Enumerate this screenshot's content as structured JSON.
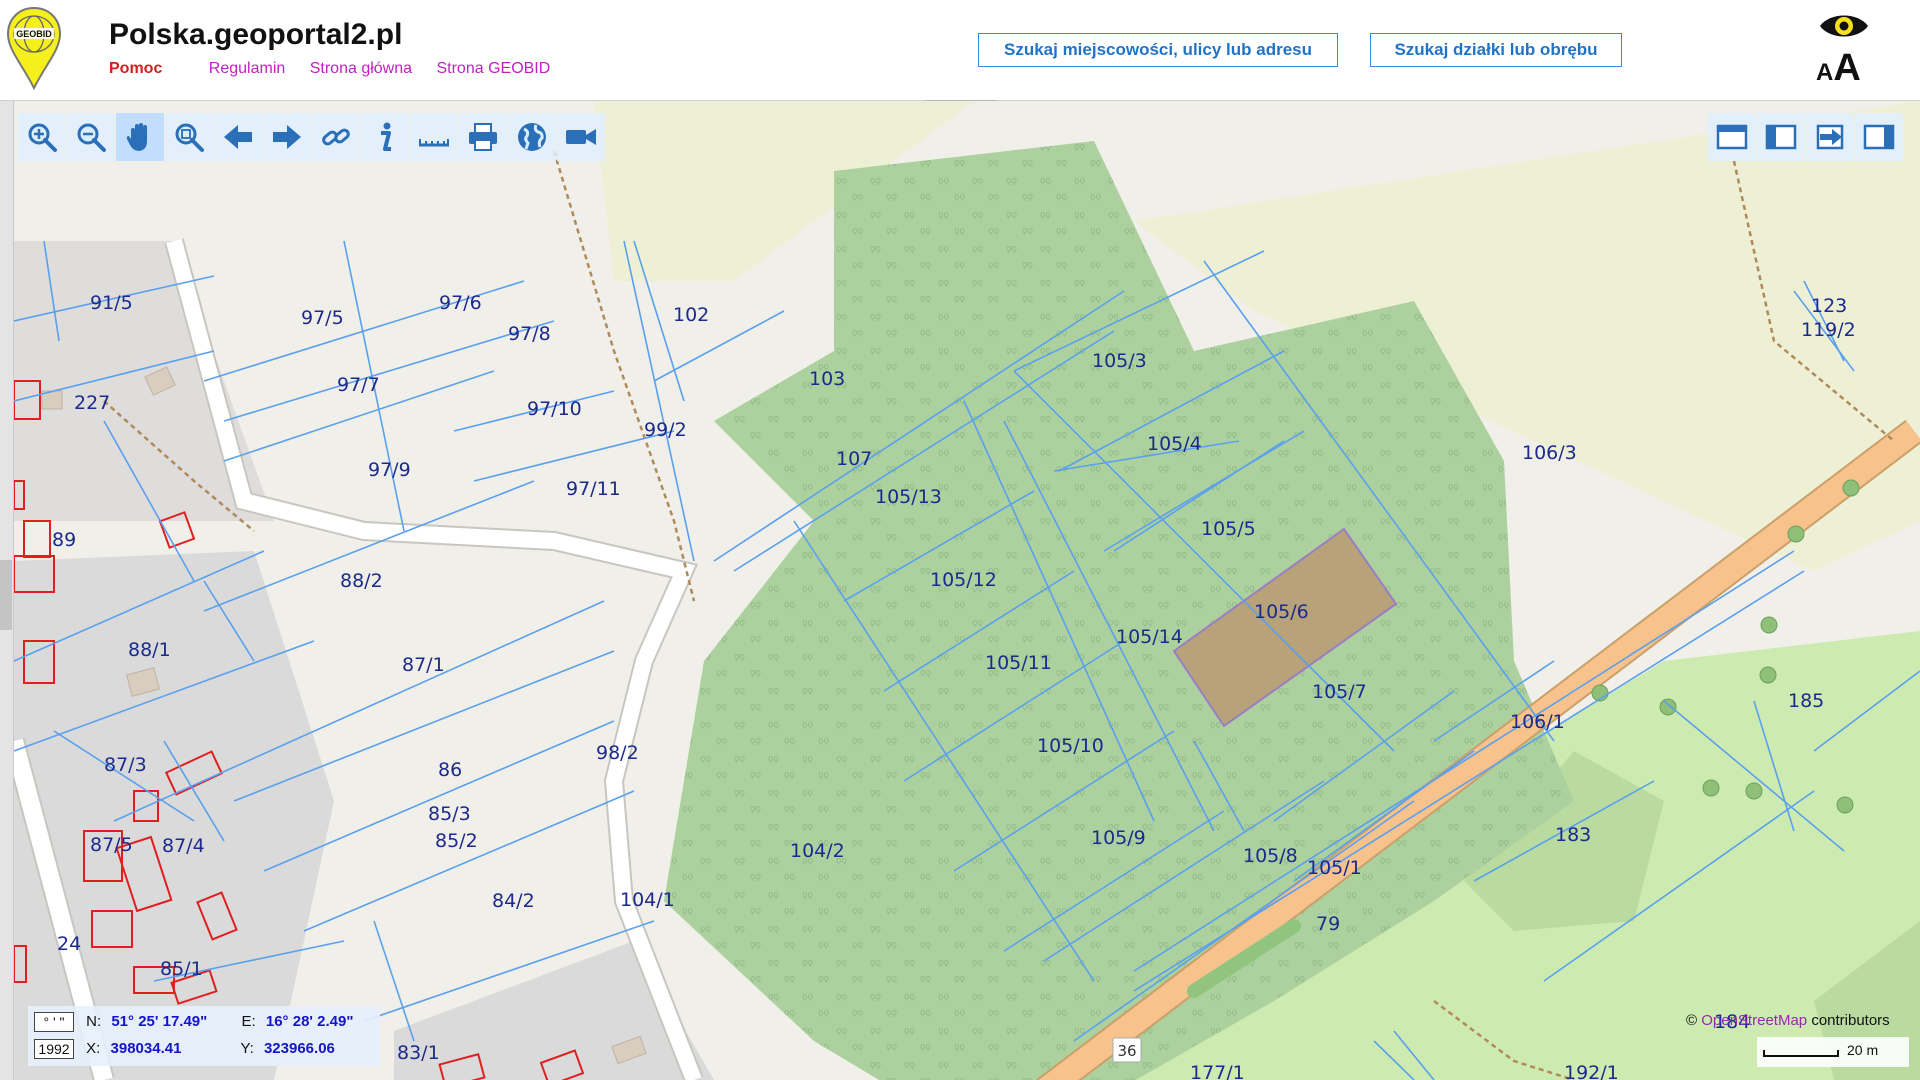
{
  "header": {
    "title": "Polska.geoportal2.pl",
    "logo_text": "GEOBID",
    "nav": [
      "Pomoc",
      "Regulamin",
      "Strona główna",
      "Strona GEOBID"
    ],
    "search_address": "Szukaj miejscowości, ulicy lub adresu",
    "search_parcel": "Szukaj działki lub obrębu",
    "font_size_small": "A",
    "font_size_large": "A"
  },
  "toolbar": {
    "tools": [
      "zoom-in-icon",
      "zoom-out-icon",
      "pan-hand-icon",
      "zoom-box-icon",
      "arrow-back-icon",
      "arrow-forward-icon",
      "link-icon",
      "info-icon",
      "measure-ruler-icon",
      "print-icon",
      "globe-icon",
      "camera-icon"
    ],
    "active_tool": "pan-hand-icon"
  },
  "right_tools": [
    "window-full-icon",
    "window-left-panel-icon",
    "export-arrow-icon",
    "window-right-panel-icon"
  ],
  "map": {
    "parcels": [
      "91/5",
      "97/5",
      "97/6",
      "97/8",
      "102",
      "97/7",
      "97/10",
      "227",
      "103",
      "105/3",
      "97/9",
      "99/2",
      "97/11",
      "107",
      "105/4",
      "106/3",
      "105/13",
      "105/5",
      "89",
      "88/2",
      "105/12",
      "105/6",
      "105/14",
      "88/1",
      "87/1",
      "105/11",
      "105/7",
      "106/1",
      "185",
      "87/3",
      "86",
      "98/2",
      "105/10",
      "85/3",
      "85/2",
      "87/5",
      "87/4",
      "183",
      "104/2",
      "105/9",
      "105/8",
      "105/1",
      "84/2",
      "104/1",
      "24",
      "79",
      "85/1",
      "83/1",
      "184",
      "177/1",
      "192/1",
      "123",
      "119/2"
    ],
    "road_number": "36",
    "selected_parcel": "105/6",
    "colors": {
      "background": "#f1efe9",
      "forest": "#add19e",
      "meadow": "#cdebb0",
      "residential": "#dddddd",
      "road": "#f7c28c",
      "parcel_border": "#5aa0ee",
      "parcel_label": "#1b2a8c",
      "selected_parcel": "#b7a27a"
    }
  },
  "coordinates": {
    "format_dms": "° ' \"",
    "format_1992": "1992",
    "n_label": "N:",
    "n_value": "51° 25' 17.49\"",
    "e_label": "E:",
    "e_value": "16° 28' 2.49\"",
    "x_label": "X:",
    "x_value": "398034.41",
    "y_label": "Y:",
    "y_value": "323966.06"
  },
  "attribution": {
    "prefix": "©",
    "link": "OpenStreetMap",
    "suffix": "contributors"
  },
  "scale": "20 m"
}
